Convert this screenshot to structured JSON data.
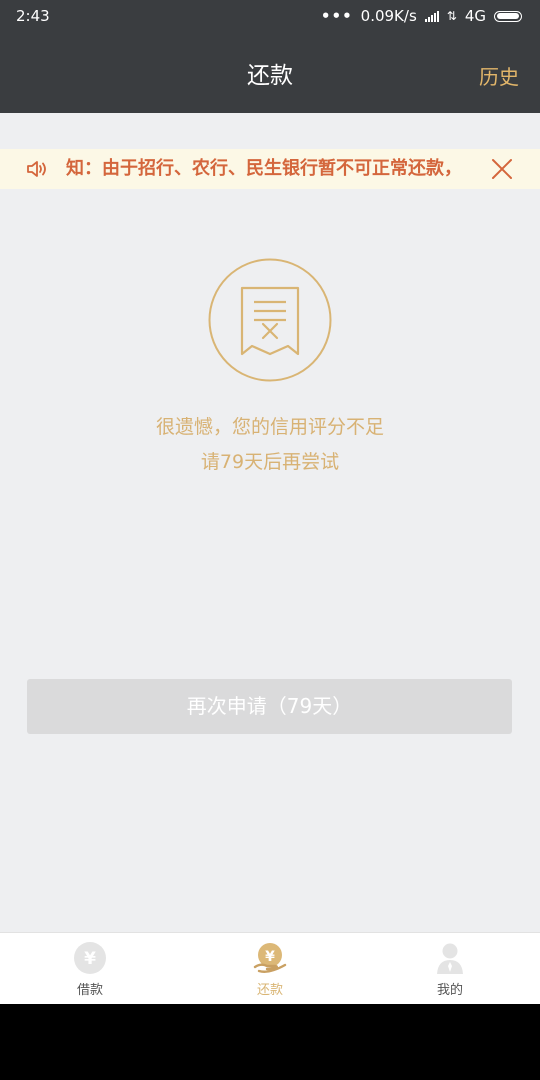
{
  "status_bar": {
    "time": "2:43",
    "speed": "0.09K/s",
    "network": "4G"
  },
  "header": {
    "title": "还款",
    "history": "历史"
  },
  "notice": {
    "text": "知：由于招行、农行、民生银行暂不可正常还款，"
  },
  "empty_state": {
    "line1": "很遗憾，您的信用评分不足",
    "line2": "请79天后再尝试"
  },
  "reapply_button": {
    "label": "再次申请（79天）"
  },
  "tabs": [
    {
      "label": "借款",
      "icon": "yen-coin-icon",
      "active": false
    },
    {
      "label": "还款",
      "icon": "yen-hand-icon",
      "active": true
    },
    {
      "label": "我的",
      "icon": "user-icon",
      "active": false
    }
  ],
  "colors": {
    "header_bg": "#3a3d40",
    "accent_gold": "#d9b574",
    "notice_text": "#d4663c",
    "notice_bg": "#fcf8e6",
    "page_bg": "#eeeff1",
    "button_disabled": "#dadadb"
  }
}
